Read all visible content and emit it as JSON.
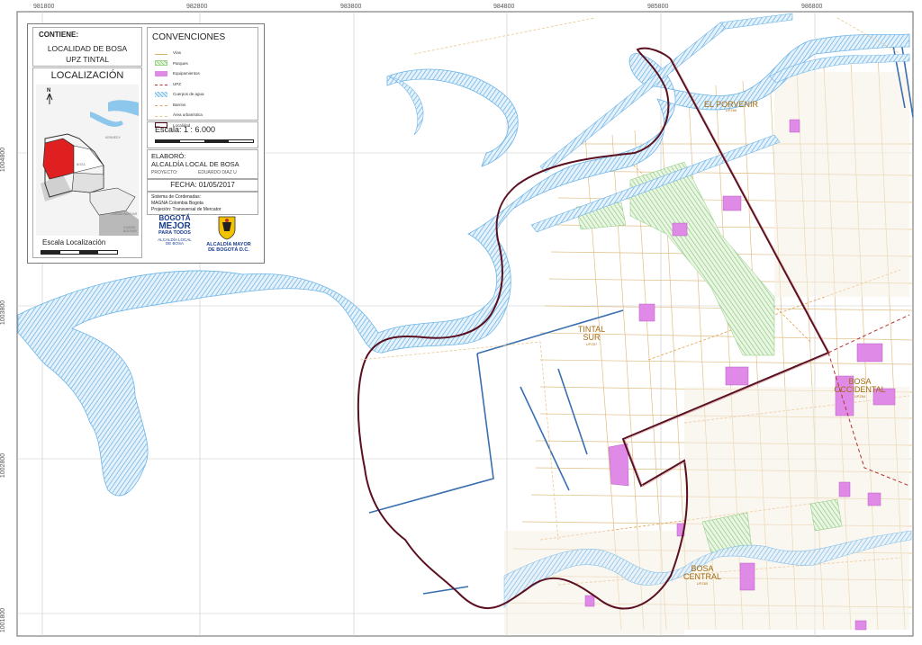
{
  "grid": {
    "x_labels": [
      "981800",
      "982800",
      "983800",
      "984800",
      "985800",
      "986800"
    ],
    "y_labels": [
      "1004800",
      "1003800",
      "1002800",
      "1001800"
    ]
  },
  "panel": {
    "contiene_label": "CONTIENE:",
    "contiene_line1": "LOCALIDAD DE BOSA",
    "contiene_line2": "UPZ TINTAL",
    "localizacion_title": "LOCALIZACIÓN",
    "inset_north": "N",
    "inset_labels": [
      "KENNEDY",
      "BOSA",
      "CIUDAD BOLÍVAR",
      "CIUDAD BOLÍVAR"
    ],
    "escala_localizacion": "Escala Localización",
    "convenciones_title": "CONVENCIONES",
    "legend": [
      {
        "label": "Vías",
        "color": "#d8b46a",
        "style": "line"
      },
      {
        "label": "Parques",
        "color": "#9bd18b",
        "style": "hatch"
      },
      {
        "label": "Equipamientos",
        "color": "#e08ae8",
        "style": "fill"
      },
      {
        "label": "UPZ",
        "color": "#b33030",
        "style": "dash"
      },
      {
        "label": "Cuerpos de agua",
        "color": "#6fb6e8",
        "style": "hatch"
      },
      {
        "label": "Barrios",
        "color": "#e0a060",
        "style": "dash"
      },
      {
        "label": "Área urbanística",
        "color": "#e8c890",
        "style": "dash"
      },
      {
        "label": "Localidad",
        "color": "#5a1020",
        "style": "box"
      }
    ],
    "escala_label": "Escala: 1  : 6.000",
    "elaboro_label": "ELABORÓ:",
    "elaboro_value": "ALCALDÍA LOCAL DE BOSA",
    "proyecto_label": "PROYECTO:",
    "proyecto_value": "EDUARDO DIAZ U",
    "fecha": "FECHA: 01/05/2017",
    "sistema_line1": "Sistema de Cordenadas:",
    "sistema_line2": "MAGNA Colombia Bogota",
    "sistema_line3": "Projeción: Transversal de Mercator",
    "logo_bogota_line1": "BOGOTÁ",
    "logo_bogota_line2": "MEJOR",
    "logo_bogota_line3": "PARA TODOS",
    "logo_bogota_line4": "ALCALDÍA LOCAL",
    "logo_bogota_line5": "DE BOSA",
    "logo_alcaldia_line1": "ALCALDÍA MAYOR",
    "logo_alcaldia_line2": "DE BOGOTÁ D.C."
  },
  "places": [
    {
      "name": "EL PORVENIR",
      "code": "UPZ86"
    },
    {
      "name": "TINTAL SUR",
      "code": "UPZ87"
    },
    {
      "name": "BOSA OCCIDENTAL",
      "code": "UPZ84"
    },
    {
      "name": "BOSA CENTRAL",
      "code": "UPZ85"
    }
  ],
  "colors": {
    "river": "#6fb6e8",
    "boundary": "#5a1020",
    "roads": "#d8b46a",
    "parks": "#9bd18b",
    "equipment": "#e08ae8",
    "canal": "#3a6fb0",
    "inset_highlight": "#e02020"
  }
}
